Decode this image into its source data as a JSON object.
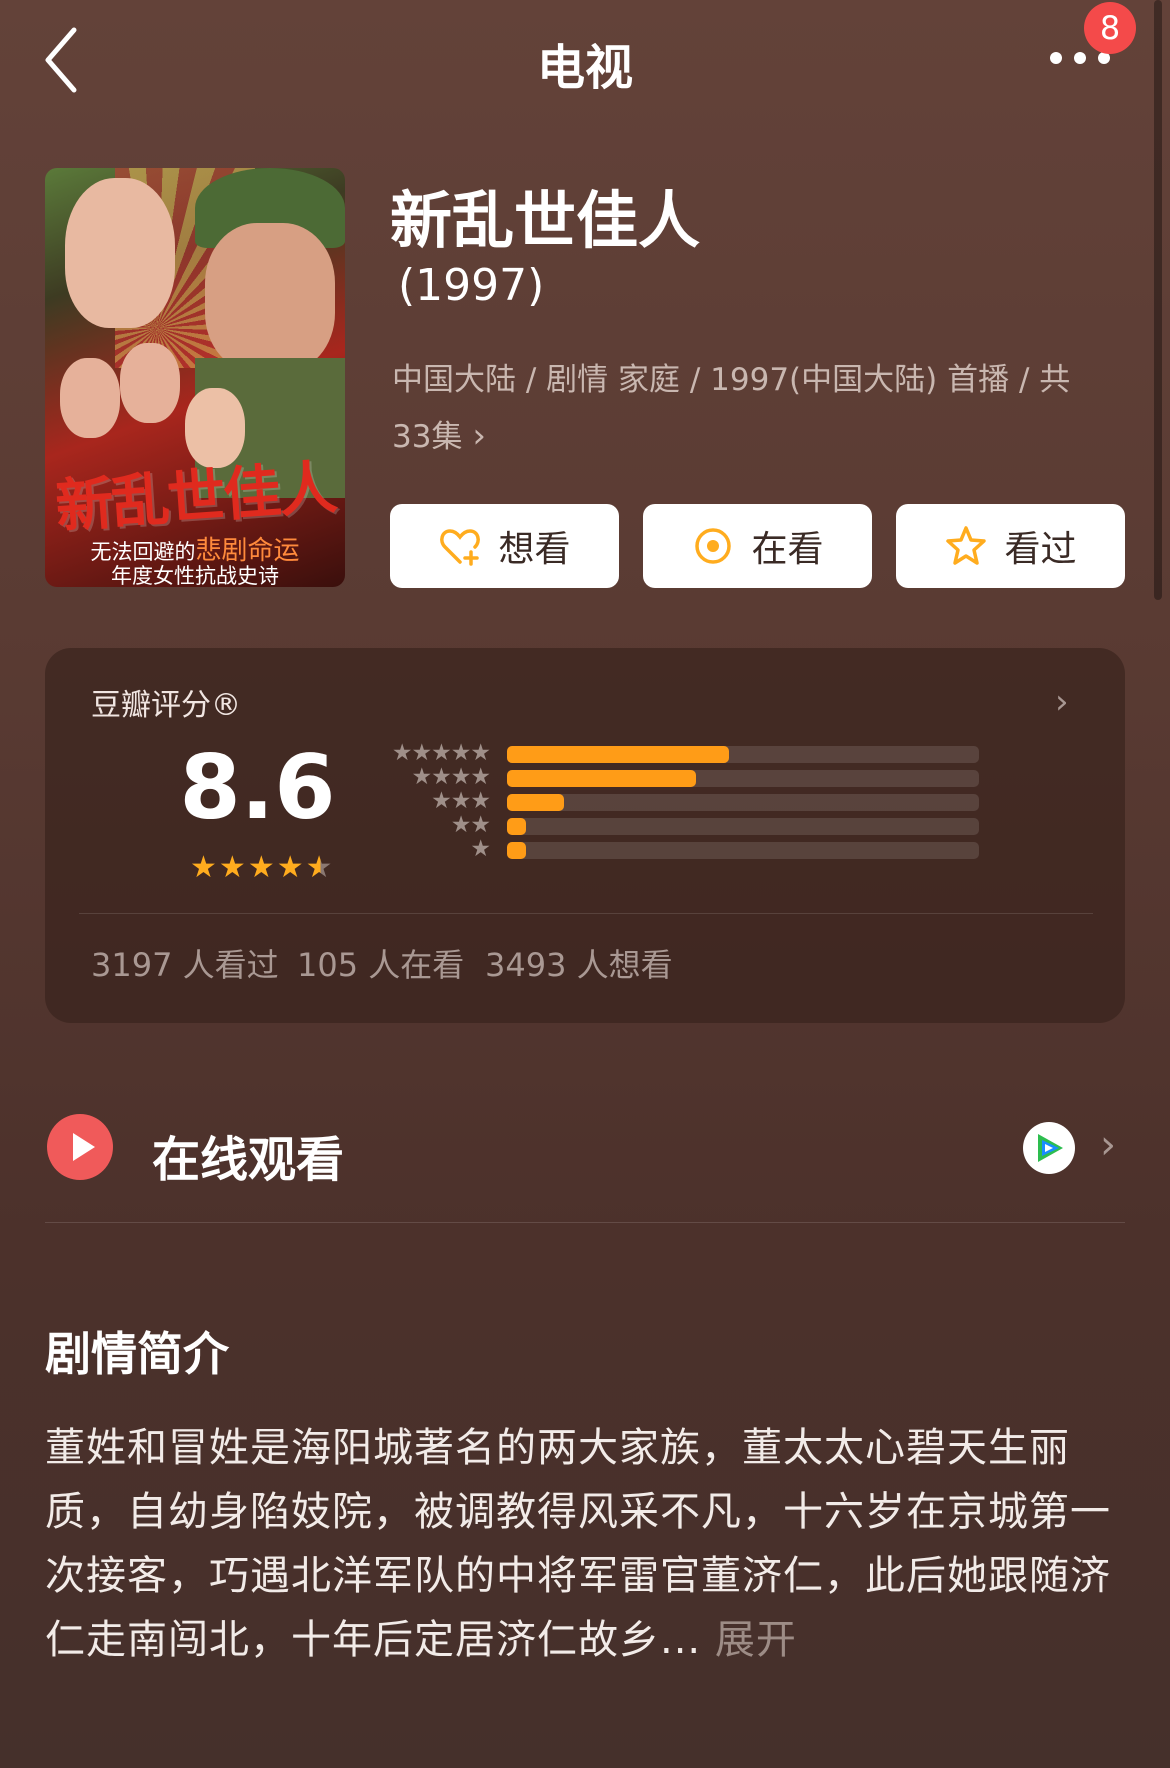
{
  "header": {
    "title": "电视",
    "notification_count": "8"
  },
  "show": {
    "name": "新乱世佳人",
    "year": "(1997)",
    "meta": "中国大陆 / 剧情 家庭 / 1997(中国大陆) 首播 / 共 33集",
    "poster": {
      "title": "新乱世佳人",
      "tagline_prefix": "无法回避的",
      "tagline_highlight": "悲剧命运",
      "tagline_2": "年度女性抗战史诗"
    }
  },
  "actions": {
    "want": "想看",
    "watching": "在看",
    "watched": "看过"
  },
  "rating": {
    "label": "豆瓣评分®",
    "score": "8.6",
    "score_stars": 4.5,
    "distribution": [
      {
        "stars": "★★★★★",
        "fraction": 0.47
      },
      {
        "stars": "★★★★",
        "fraction": 0.4
      },
      {
        "stars": "★★★",
        "fraction": 0.12
      },
      {
        "stars": "★★",
        "fraction": 0.04
      },
      {
        "stars": "★",
        "fraction": 0.04
      }
    ],
    "counts": {
      "watched": "3197 人看过",
      "watching": "105 人在看",
      "want": "3493 人想看"
    },
    "accent_color": "#ff9c17"
  },
  "watch_online": {
    "label": "在线观看",
    "provider_icon": "tencent-video-icon"
  },
  "synopsis": {
    "title": "剧情简介",
    "text": "董姓和冒姓是海阳城著名的两大家族，董太太心碧天生丽质，自幼身陷妓院，被调教得风采不凡，十六岁在京城第一次接客，巧遇北洋军队的中将军雷官董济仁，此后她跟随济仁走南闯北，十年后定居济仁故乡...",
    "expand_label": "展开"
  }
}
